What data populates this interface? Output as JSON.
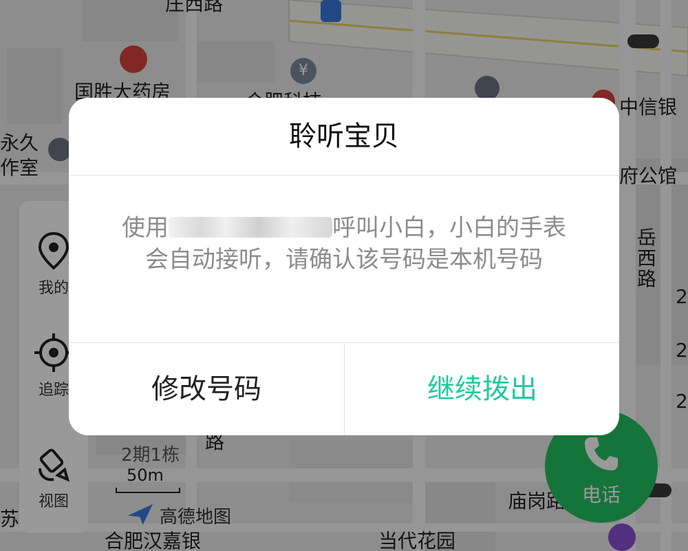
{
  "map": {
    "labels": {
      "street_top": "庄西路",
      "pharmacy": "国胜大药房",
      "hefei_partial": "合肥科技",
      "citic_bank": "中信银",
      "yongjiu_line1": "永久",
      "yongjiu_line2": "作室",
      "office_partial": "府公馆",
      "yuexi_road": "岳西路",
      "phase2": "2期1栋",
      "road_char": "路",
      "scale": "50m",
      "amap_logo": "高德地图",
      "hanjia_bank": "合肥汉嘉银",
      "miaogang": "庙岗路",
      "dangdai": "当代花园",
      "edge_2a": "2",
      "edge_2b": "2",
      "edge_2c": "2",
      "left_char": "苏"
    },
    "icons": [
      "bus-stop-icon",
      "pharmacy-icon",
      "bank-yen-icon",
      "exit-icon",
      "bank-icon",
      "traffic-light-icon",
      "shopping-cart-icon",
      "amap-logo-icon",
      "scissors-icon"
    ]
  },
  "left_panel": {
    "items": [
      {
        "label": "我的",
        "icon": "location-pin-icon"
      },
      {
        "label": "追踪",
        "icon": "crosshair-icon"
      },
      {
        "label": "视图",
        "icon": "satellite-icon"
      }
    ]
  },
  "call_button": {
    "label": "电话",
    "color": "#23c161"
  },
  "dialog": {
    "title": "聆听宝贝",
    "message_before": "使用",
    "message_after": "呼叫小白，小白的手表会自动接听，请确认该号码是本机号码",
    "cancel_label": "修改号码",
    "confirm_label": "继续拨出",
    "confirm_color": "#23c8a0"
  }
}
